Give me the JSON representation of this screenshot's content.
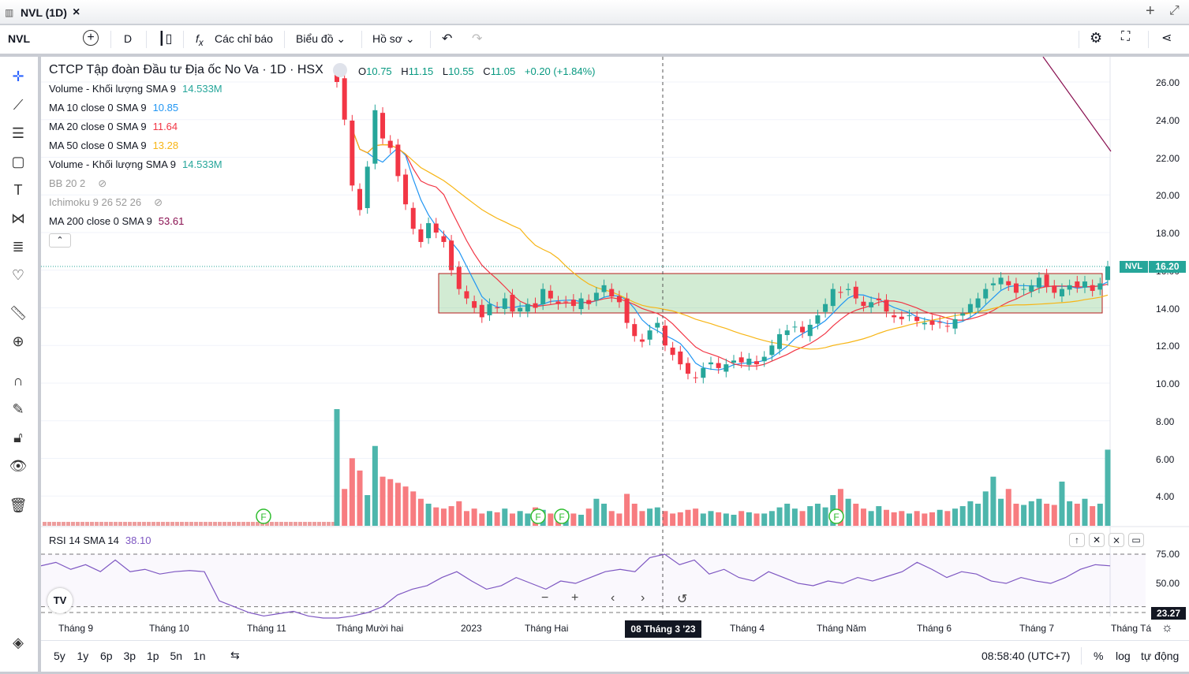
{
  "tab": {
    "title": "NVL (1D)",
    "close": "×",
    "plus": "+",
    "expand": "⤢"
  },
  "toolbar": {
    "symbol": "NVL",
    "interval": "D",
    "indicators": "Các chỉ báo",
    "chart": "Biểu đồ",
    "profile": "Hồ sơ"
  },
  "header": {
    "name": "CTCP Tập đoàn Đầu tư Địa ốc No Va · 1D · HSX",
    "o_l": "O",
    "o": "10.75",
    "h_l": "H",
    "h": "11.15",
    "l_l": "L",
    "l": "10.55",
    "c_l": "C",
    "c": "11.05",
    "chg": "+0.20 (+1.84%)"
  },
  "legend": [
    {
      "label": "Volume - Khối lượng SMA 9",
      "value": "14.533M",
      "color": "#26a69a"
    },
    {
      "label": "MA 10 close 0 SMA 9",
      "value": "10.85",
      "color": "#2196f3"
    },
    {
      "label": "MA 20 close 0 SMA 9",
      "value": "11.64",
      "color": "#f23645"
    },
    {
      "label": "MA 50 close 0 SMA 9",
      "value": "13.28",
      "color": "#f7b515"
    },
    {
      "label": "Volume - Khối lượng SMA 9",
      "value": "14.533M",
      "color": "#26a69a"
    },
    {
      "label": "BB 20 2",
      "value": "",
      "color": "#aaa"
    },
    {
      "label": "Ichimoku 9 26 52 26",
      "value": "",
      "color": "#aaa"
    },
    {
      "label": "MA 200 close 0 SMA 9",
      "value": "53.61",
      "color": "#880e4f"
    }
  ],
  "price_axis": [
    "26.00",
    "24.00",
    "22.00",
    "20.00",
    "18.00",
    "16.00",
    "14.00",
    "12.00",
    "10.00",
    "8.00",
    "6.00",
    "4.00"
  ],
  "last_price": {
    "symbol": "NVL",
    "value": "16.20"
  },
  "rsi": {
    "label": "RSI 14 SMA 14",
    "value": "38.10",
    "axis": [
      "75.00",
      "50.00"
    ],
    "badge": "23.27",
    "values": [
      65,
      68,
      62,
      66,
      60,
      70,
      60,
      62,
      58,
      60,
      61,
      60,
      35,
      30,
      25,
      22,
      24,
      26,
      22,
      18,
      20,
      22,
      25,
      30,
      40,
      45,
      48,
      55,
      60,
      52,
      45,
      48,
      55,
      50,
      45,
      52,
      50,
      55,
      60,
      62,
      60,
      72,
      75,
      66,
      70,
      58,
      62,
      55,
      52,
      60,
      55,
      50,
      48,
      52,
      50,
      55,
      52,
      56,
      60,
      68,
      62,
      55,
      60,
      58,
      52,
      50,
      55,
      52,
      50,
      55,
      62,
      66,
      65
    ]
  },
  "time_axis": [
    "Tháng 9",
    "Tháng 10",
    "Tháng 11",
    "Tháng Mười hai",
    "2023",
    "Tháng Hai",
    "Tháng 4",
    "Tháng Năm",
    "Tháng 6",
    "Tháng 7",
    "Tháng Tá"
  ],
  "crosshair_date": "08 Tháng 3 '23",
  "ranges": [
    "5y",
    "1y",
    "6p",
    "3p",
    "1p",
    "5n",
    "1n"
  ],
  "clock": "08:58:40 (UTC+7)",
  "scale": {
    "pct": "%",
    "log": "log",
    "auto": "tự động"
  },
  "events": [
    "F",
    "F",
    "F",
    "F"
  ],
  "chart_data": {
    "type": "candlestick",
    "closes": [
      26,
      24,
      20.5,
      19.2,
      21.5,
      24.5,
      23,
      22.5,
      21,
      19.5,
      18.2,
      17.5,
      18.5,
      18,
      17.5,
      16,
      15,
      14.5,
      14,
      13.5,
      14.2,
      14,
      14.5,
      13.8,
      14,
      14.2,
      14,
      15,
      14.5,
      14.2,
      14.3,
      14.1,
      14.5,
      14.2,
      14.8,
      15.2,
      14.6,
      14.3,
      13.2,
      12.5,
      12.2,
      12.8,
      13.2,
      12,
      11.5,
      11,
      10.5,
      10.3,
      10.8,
      11.1,
      10.8,
      11,
      11.2,
      11.1,
      11.3,
      11,
      11.4,
      12,
      12.6,
      12.8,
      13,
      12.7,
      13.1,
      13.6,
      14.2,
      15,
      14.8,
      15,
      14.5,
      14.1,
      14.3,
      14.4,
      13.8,
      13.5,
      13.4,
      13.6,
      13.3,
      13.2,
      13.1,
      13.2,
      13,
      13.4,
      13.7,
      14.2,
      14.5,
      15,
      15.3,
      15.6,
      15.2,
      14.8,
      15,
      15.2,
      15.6,
      15.1,
      14.8,
      15,
      15.2,
      15.1,
      15.4,
      14.9,
      15.3,
      16.2
    ],
    "volumes": [
      95,
      30,
      55,
      45,
      25,
      65,
      40,
      38,
      35,
      32,
      28,
      22,
      18,
      15,
      14,
      16,
      20,
      12,
      14,
      10,
      12,
      11,
      14,
      10,
      12,
      10,
      15,
      13,
      10,
      11,
      12,
      10,
      9,
      14,
      22,
      18,
      12,
      10,
      26,
      18,
      12,
      14,
      15,
      12,
      10,
      11,
      13,
      14,
      10,
      12,
      11,
      10,
      9,
      12,
      11,
      10,
      10,
      12,
      15,
      18,
      14,
      12,
      16,
      18,
      15,
      25,
      30,
      22,
      18,
      14,
      12,
      16,
      13,
      11,
      12,
      10,
      12,
      10,
      11,
      13,
      12,
      14,
      16,
      20,
      18,
      28,
      40,
      22,
      30,
      18,
      17,
      20,
      22,
      18,
      17,
      36,
      20,
      18,
      22,
      16,
      18,
      62
    ],
    "ylim": [
      10,
      26
    ]
  }
}
